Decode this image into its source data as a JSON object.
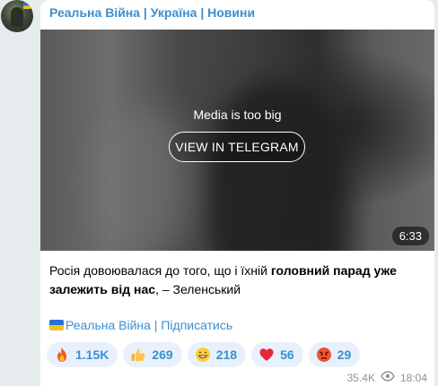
{
  "channel": {
    "name": "Реальна Війна | Україна | Новини"
  },
  "media": {
    "notice": "Media is too big",
    "button_label": "VIEW IN TELEGRAM",
    "duration": "6:33"
  },
  "message": {
    "text_part1": "Росія довоювалася до того, що і їхній ",
    "text_bold": "головний парад уже залежить від нас",
    "text_part2": ", – Зеленський"
  },
  "signature": {
    "text": "Реальна Війна | Підписатись",
    "flag_icon": "ukraine-flag-icon"
  },
  "reactions": [
    {
      "icon": "fire-icon",
      "count": "1.15K"
    },
    {
      "icon": "thumbs-up-icon",
      "count": "269"
    },
    {
      "icon": "grinning-face-icon",
      "count": "218"
    },
    {
      "icon": "heart-icon",
      "count": "56"
    },
    {
      "icon": "angry-face-icon",
      "count": "29"
    }
  ],
  "meta": {
    "views": "35.4K",
    "time": "18:04",
    "views_icon": "eye-icon"
  },
  "colors": {
    "accent": "#3a8fd3",
    "background": "#e6ebee",
    "reaction_bg": "#e8f1fb",
    "meta_text": "#8a949d"
  }
}
